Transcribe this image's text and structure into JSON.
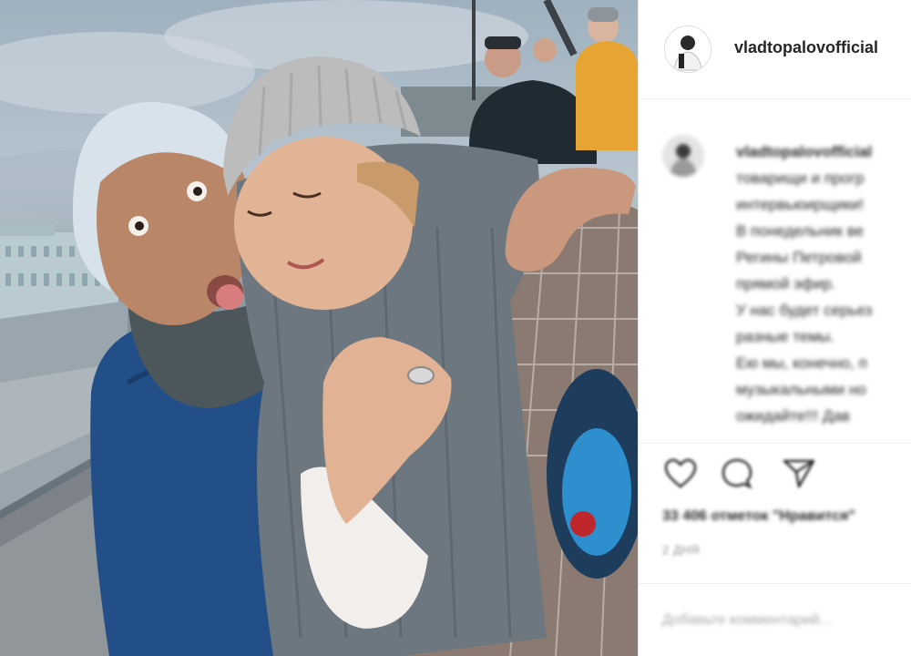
{
  "post": {
    "username": "vladtopalovofficial",
    "caption": {
      "username": "vladtopalovofficial",
      "lines": [
        "товарищи и прогр",
        "интервьюирщики!",
        "В понедельник ве",
        "Регины Петровой",
        "прямой эфир.",
        "У нас будет серьез",
        "разные темы.",
        "Ею мы, конечно, п",
        "музыкальными но",
        "ожидайте!!! Дав"
      ]
    },
    "likes_text": "33 406 отметок \"Нравится\"",
    "date_text": "2 ДНЯ",
    "comment_placeholder": "Добавьте комментарий..."
  },
  "icons": {
    "like": "heart-icon",
    "comment": "comment-icon",
    "share": "share-icon"
  },
  "colors": {
    "text": "#262626",
    "muted": "#8e8e8e",
    "border": "#efefef"
  }
}
